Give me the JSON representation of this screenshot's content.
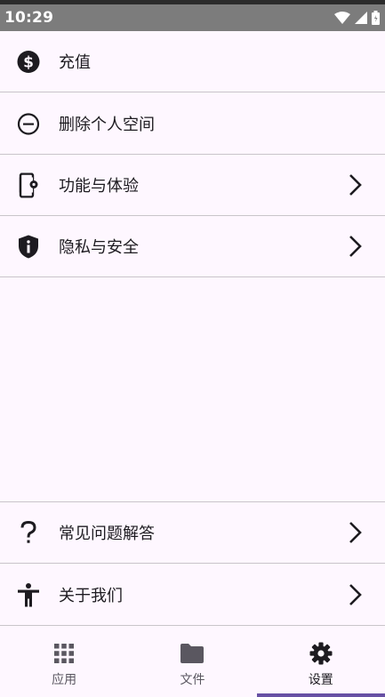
{
  "status_bar": {
    "time": "10:29"
  },
  "menu_top": [
    {
      "label": "充值",
      "icon": "dollar-circle-icon",
      "has_chevron": false
    },
    {
      "label": "删除个人空间",
      "icon": "minus-circle-icon",
      "has_chevron": false
    },
    {
      "label": "功能与体验",
      "icon": "phone-settings-icon",
      "has_chevron": true
    },
    {
      "label": "隐私与安全",
      "icon": "shield-info-icon",
      "has_chevron": true
    }
  ],
  "menu_bottom": [
    {
      "label": "常见问题解答",
      "icon": "question-mark-icon",
      "has_chevron": true
    },
    {
      "label": "关于我们",
      "icon": "accessibility-person-icon",
      "has_chevron": true
    }
  ],
  "bottom_nav": {
    "items": [
      {
        "label": "应用",
        "icon": "apps-grid-icon",
        "active": false
      },
      {
        "label": "文件",
        "icon": "folder-icon",
        "active": false
      },
      {
        "label": "设置",
        "icon": "gear-icon",
        "active": true
      }
    ],
    "accent_color": "#6750a4"
  },
  "colors": {
    "background": "#fef7ff",
    "status_bar": "#7c7c7c",
    "divider": "#c9c5ca",
    "icon": "#1d1b20"
  }
}
